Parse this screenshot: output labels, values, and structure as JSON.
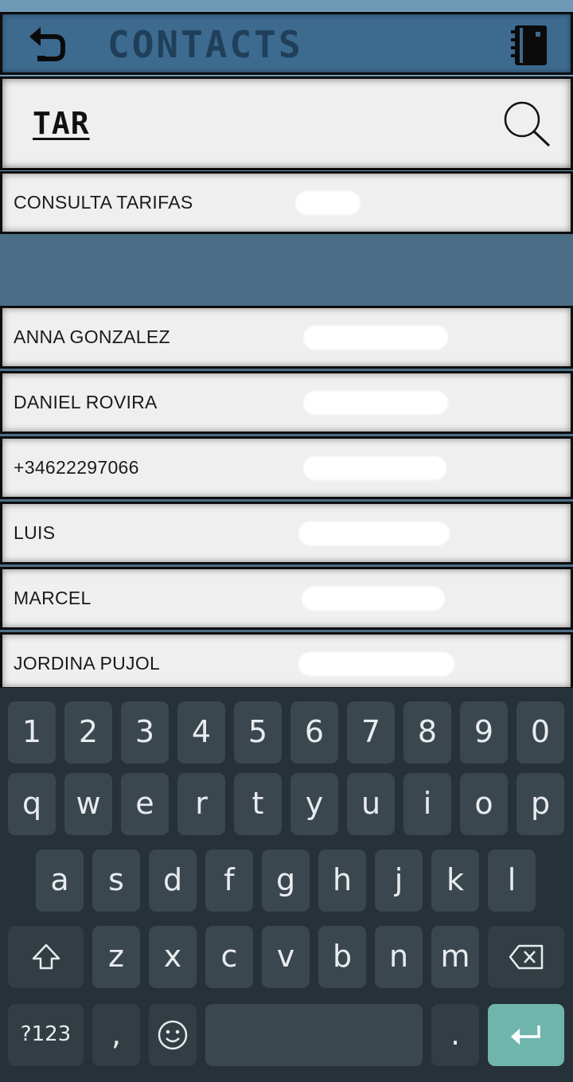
{
  "header": {
    "title": "CONTACTS",
    "back_icon": "back-arrow-icon",
    "book_icon": "address-book-icon",
    "color": "#3d6a8f"
  },
  "search": {
    "value": "TAR",
    "icon": "search-icon"
  },
  "contacts": [
    {
      "name": "CONSULTA TARIFAS"
    },
    {
      "name": "ANNA GONZALEZ"
    },
    {
      "name": "DANIEL ROVIRA"
    },
    {
      "name": "+34622297066"
    },
    {
      "name": "LUIS"
    },
    {
      "name": "MARCEL"
    },
    {
      "name": "JORDINA PUJOL"
    }
  ],
  "keyboard": {
    "row1": [
      "1",
      "2",
      "3",
      "4",
      "5",
      "6",
      "7",
      "8",
      "9",
      "0"
    ],
    "row2": [
      "q",
      "w",
      "e",
      "r",
      "t",
      "y",
      "u",
      "i",
      "o",
      "p"
    ],
    "row3": [
      "a",
      "s",
      "d",
      "f",
      "g",
      "h",
      "j",
      "k",
      "l"
    ],
    "row4": [
      "z",
      "x",
      "c",
      "v",
      "b",
      "n",
      "m"
    ],
    "symbols_label": "?123",
    "comma": ",",
    "period": ".",
    "accent_color": "#6fb5ab"
  }
}
